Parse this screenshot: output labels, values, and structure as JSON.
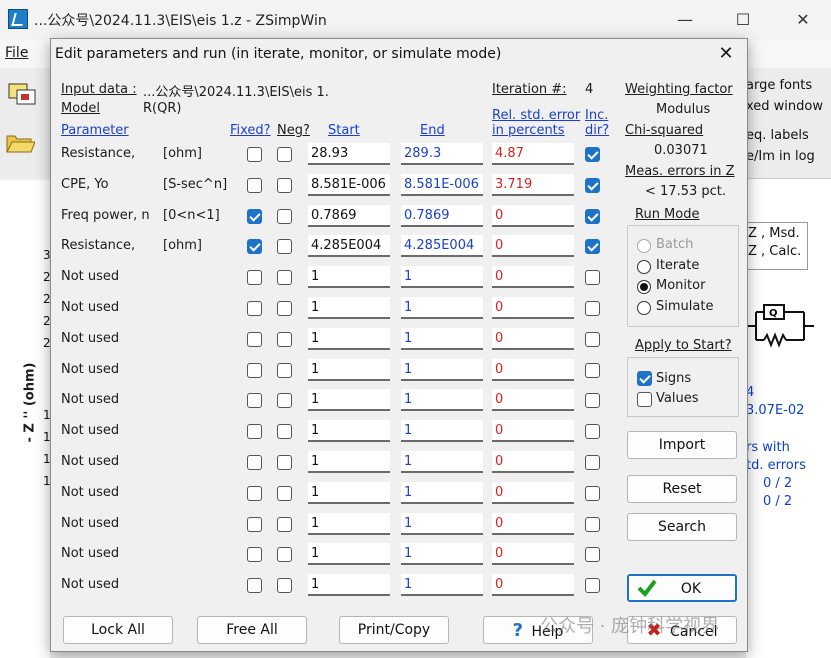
{
  "app": {
    "title": "...公众号\\2024.11.3\\EIS\\eis 1.z - ZSimpWin",
    "menu_file": "File",
    "right_toolbar": [
      "arge fonts",
      "xed window",
      "eq. labels",
      "e/Im in log"
    ],
    "right_legend": [
      "Z , Msd.",
      "Z , Calc."
    ],
    "right_values": [
      "4",
      "3.07E-02"
    ],
    "right_notes": [
      "rs with",
      "td. errors",
      "0 / 2",
      "0 / 2"
    ],
    "axis_numbers": [
      "3",
      "2",
      "2",
      "2",
      "2",
      "1",
      "1",
      "1",
      "1"
    ],
    "z_axis_label": "- Z '' (ohm)"
  },
  "dialog": {
    "title": "Edit parameters and run (in iterate, monitor, or simulate mode)",
    "input_data_label": "Input data :",
    "input_data_value": "...公众号\\2024.11.3\\EIS\\eis 1.",
    "model_label": "Model",
    "model_value": "R(QR)",
    "iteration_label": "Iteration #:",
    "iteration_value": "4",
    "headers": {
      "parameter": "Parameter",
      "fixed": "Fixed?",
      "neg": "Neg?",
      "start": "Start",
      "end": "End",
      "rel_err_1": "Rel. std. error",
      "rel_err_2": "in percents",
      "inc_1": "Inc.",
      "inc_2": "dir?"
    },
    "rows": [
      {
        "name": "Resistance,",
        "unit": "[ohm]",
        "fixed": false,
        "neg": false,
        "start": "28.93",
        "end": "289.3",
        "err": "4.87",
        "inc": true
      },
      {
        "name": "CPE,  Yo",
        "unit": "[S-sec^n]",
        "fixed": false,
        "neg": false,
        "start": "8.581E-006",
        "end": "8.581E-006",
        "err": "3.719",
        "inc": true
      },
      {
        "name": "Freq power, n",
        "unit": "[0<n<1]",
        "fixed": true,
        "neg": false,
        "start": "0.7869",
        "end": "0.7869",
        "err": "0",
        "inc": true
      },
      {
        "name": "Resistance,",
        "unit": "[ohm]",
        "fixed": true,
        "neg": false,
        "start": "4.285E004",
        "end": "4.285E004",
        "err": "0",
        "inc": true
      },
      {
        "name": "Not used",
        "unit": "",
        "fixed": false,
        "neg": false,
        "start": "1",
        "end": "1",
        "err": "0",
        "inc": false
      },
      {
        "name": "Not used",
        "unit": "",
        "fixed": false,
        "neg": false,
        "start": "1",
        "end": "1",
        "err": "0",
        "inc": false
      },
      {
        "name": "Not used",
        "unit": "",
        "fixed": false,
        "neg": false,
        "start": "1",
        "end": "1",
        "err": "0",
        "inc": false
      },
      {
        "name": "Not used",
        "unit": "",
        "fixed": false,
        "neg": false,
        "start": "1",
        "end": "1",
        "err": "0",
        "inc": false
      },
      {
        "name": "Not used",
        "unit": "",
        "fixed": false,
        "neg": false,
        "start": "1",
        "end": "1",
        "err": "0",
        "inc": false
      },
      {
        "name": "Not used",
        "unit": "",
        "fixed": false,
        "neg": false,
        "start": "1",
        "end": "1",
        "err": "0",
        "inc": false
      },
      {
        "name": "Not used",
        "unit": "",
        "fixed": false,
        "neg": false,
        "start": "1",
        "end": "1",
        "err": "0",
        "inc": false
      },
      {
        "name": "Not used",
        "unit": "",
        "fixed": false,
        "neg": false,
        "start": "1",
        "end": "1",
        "err": "0",
        "inc": false
      },
      {
        "name": "Not used",
        "unit": "",
        "fixed": false,
        "neg": false,
        "start": "1",
        "end": "1",
        "err": "0",
        "inc": false
      },
      {
        "name": "Not used",
        "unit": "",
        "fixed": false,
        "neg": false,
        "start": "1",
        "end": "1",
        "err": "0",
        "inc": false
      },
      {
        "name": "Not used",
        "unit": "",
        "fixed": false,
        "neg": false,
        "start": "1",
        "end": "1",
        "err": "0",
        "inc": false
      }
    ],
    "side": {
      "weighting_label": "Weighting factor",
      "weighting_value": "Modulus",
      "chi_label": "Chi-squared",
      "chi_value": "0.03071",
      "meas_label": "Meas. errors in Z",
      "meas_value": "< 17.53 pct.",
      "run_mode_label": "Run Mode",
      "run_modes": [
        "Batch",
        "Iterate",
        "Monitor",
        "Simulate"
      ],
      "run_mode_selected": "Monitor",
      "apply_label": "Apply to Start?",
      "apply_signs": "Signs",
      "apply_signs_checked": true,
      "apply_values": "Values",
      "apply_values_checked": false,
      "import_label": "Import",
      "reset_label": "Reset",
      "search_label": "Search",
      "ok_label": "OK"
    },
    "bottom": {
      "lock_all": "Lock All",
      "free_all": "Free All",
      "print_copy": "Print/Copy",
      "help": "Help",
      "cancel": "Cancel"
    }
  },
  "watermark": "公众号 · 庞钟科学视界",
  "colors": {
    "accent": "#1e73c8",
    "error_text": "#e02020",
    "end_text": "#1a3fd0"
  }
}
